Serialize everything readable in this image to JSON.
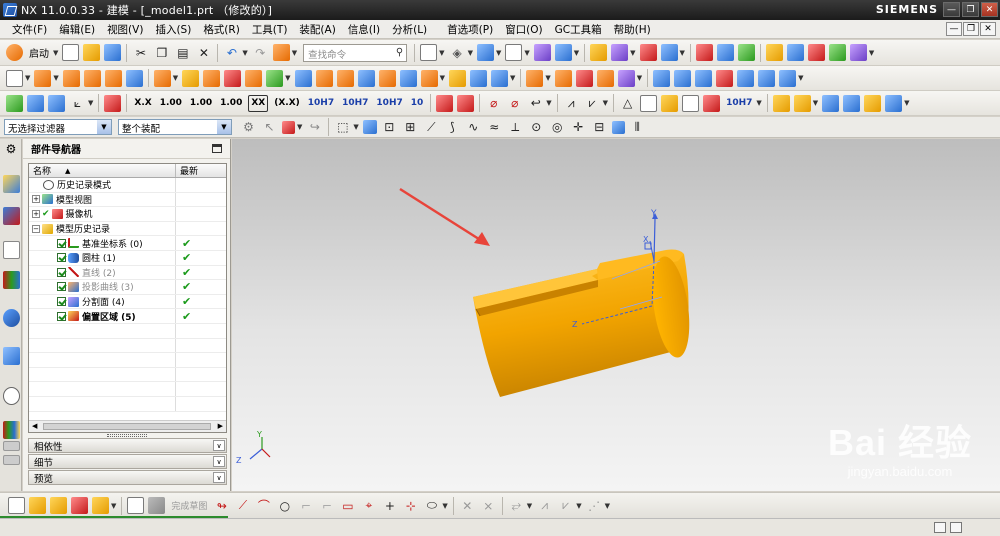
{
  "window": {
    "title": "NX 11.0.0.33 - 建模 - [_model1.prt （修改的）]",
    "brand": "SIEMENS",
    "min_glyph": "—",
    "restore_glyph": "❐",
    "close_glyph": "✕"
  },
  "menu": {
    "items": [
      "文件(F)",
      "编辑(E)",
      "视图(V)",
      "插入(S)",
      "格式(R)",
      "工具(T)",
      "装配(A)",
      "信息(I)",
      "分析(L)",
      "首选项(P)",
      "窗口(O)",
      "GC工具箱",
      "帮助(H)"
    ]
  },
  "toolbar": {
    "start_label": "启动",
    "search_placeholder": "查找命令",
    "search_icon": "⚲",
    "dim_labels": [
      "X.X",
      "1.00±.05",
      "1.00+.05-.02",
      "1.00+.00-.02",
      "XX",
      "(X.X)",
      "10H7",
      "10H7(+0.018)",
      "10H7(0.015)",
      "10(+0.018)"
    ],
    "dim_display": [
      "X.X",
      "1.00",
      "1.00",
      "1.00",
      "XX",
      "(X.X)",
      "10H7",
      "10H7",
      "10H7",
      "10"
    ]
  },
  "selection_bar": {
    "filter_value": "无选择过滤器",
    "scope_value": "整个装配"
  },
  "navigator": {
    "title": "部件导航器",
    "col_name": "名称",
    "col_latest": "最新",
    "rows": [
      {
        "label": "历史记录模式",
        "indent": 1,
        "status": "",
        "style": "normal"
      },
      {
        "label": "模型视图",
        "indent": 0,
        "status": "",
        "style": "normal",
        "expander": "+"
      },
      {
        "label": "摄像机",
        "indent": 0,
        "status": "",
        "style": "normal",
        "expander": "+"
      },
      {
        "label": "模型历史记录",
        "indent": 0,
        "status": "",
        "style": "normal",
        "expander": "−"
      },
      {
        "label": "基准坐标系 (0)",
        "indent": 2,
        "status": "✔",
        "style": "normal"
      },
      {
        "label": "圆柱 (1)",
        "indent": 2,
        "status": "✔",
        "style": "normal"
      },
      {
        "label": "直线 (2)",
        "indent": 2,
        "status": "✔",
        "style": "gray"
      },
      {
        "label": "投影曲线 (3)",
        "indent": 2,
        "status": "✔",
        "style": "gray"
      },
      {
        "label": "分割面 (4)",
        "indent": 2,
        "status": "✔",
        "style": "normal"
      },
      {
        "label": "偏置区域 (5)",
        "indent": 2,
        "status": "✔",
        "style": "bold"
      }
    ],
    "panels": [
      "相依性",
      "细节",
      "预览"
    ],
    "panel_chevron": "∨"
  },
  "bottom_toolbar": {
    "sketch_label": "完成草图"
  },
  "watermark": {
    "logo": "Bai 经验",
    "url": "jingyan.baidu.com"
  },
  "colors": {
    "part_fill": "#f2a400",
    "arrow": "#e8443a"
  },
  "axes": {
    "x": "X",
    "y": "Y",
    "z": "Z"
  }
}
